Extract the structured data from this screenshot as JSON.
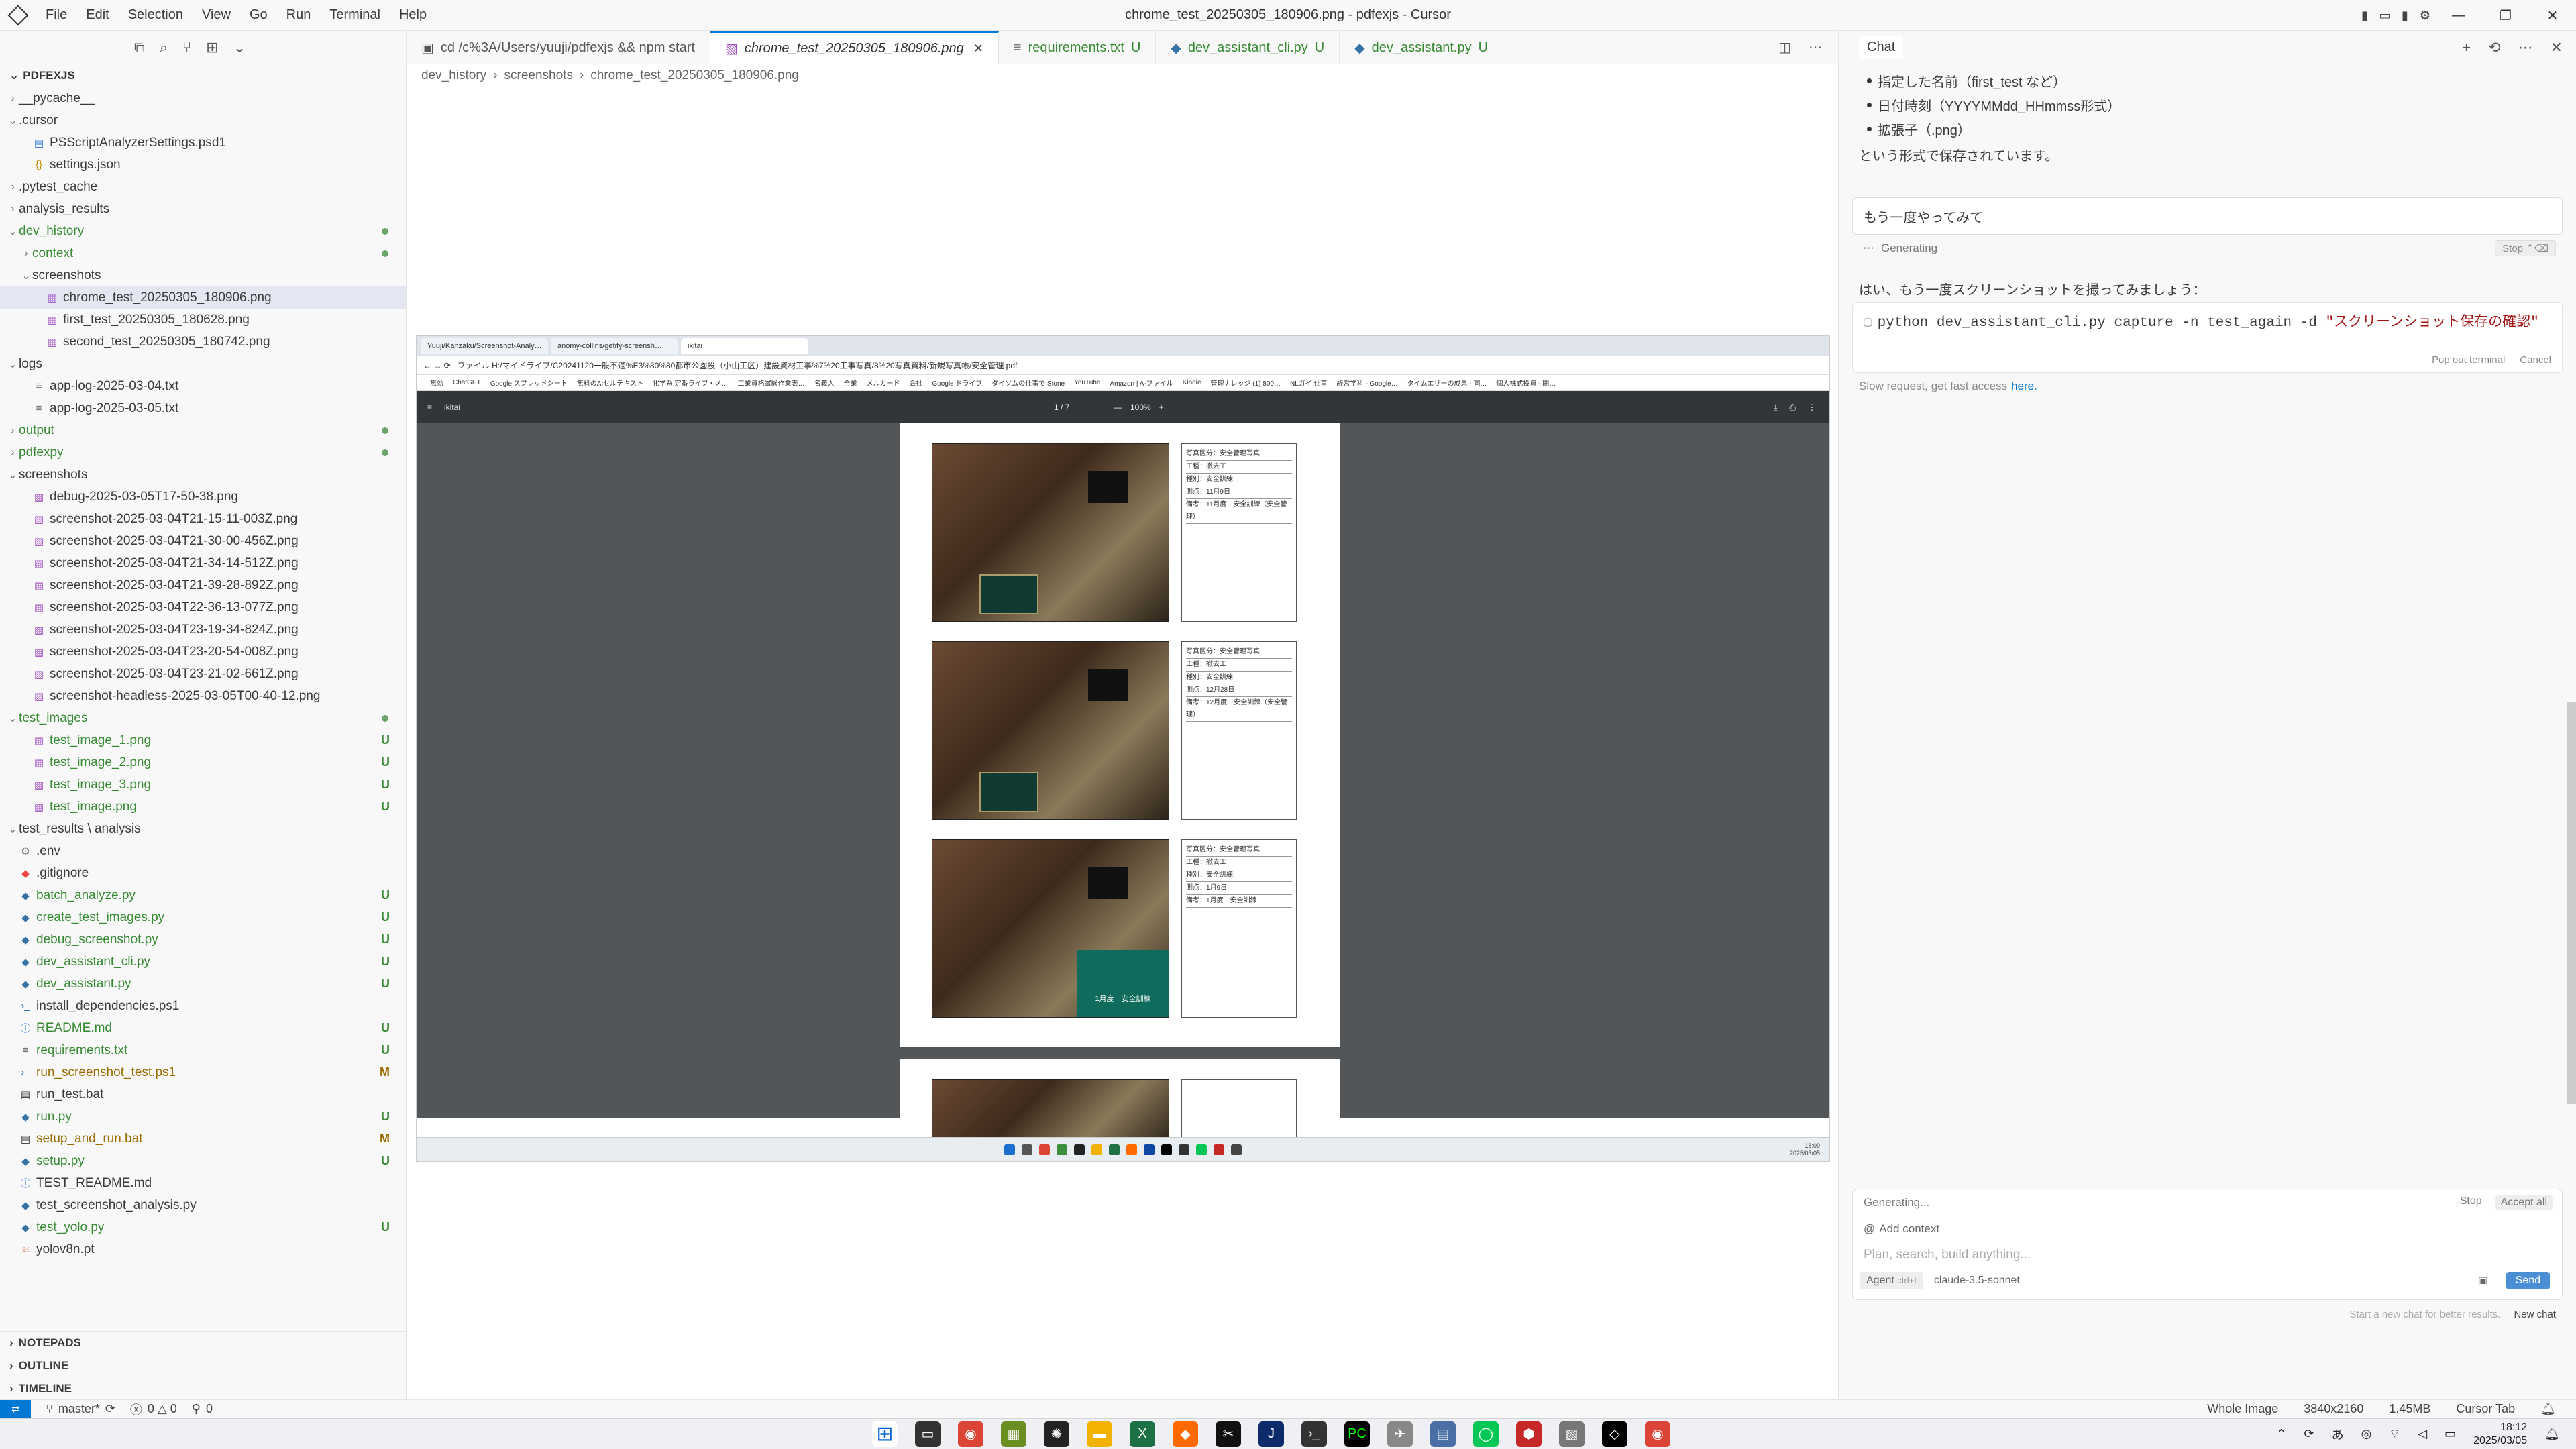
{
  "titlebar": {
    "menu": [
      "File",
      "Edit",
      "Selection",
      "View",
      "Go",
      "Run",
      "Terminal",
      "Help"
    ],
    "title": "chrome_test_20250305_180906.png - pdfexjs - Cursor"
  },
  "explorer": {
    "header": "PDFEXJS",
    "items": [
      {
        "label": "__pycache__",
        "kind": "folder",
        "open": false,
        "level": 1,
        "status": ""
      },
      {
        "label": ".cursor",
        "kind": "folder",
        "open": true,
        "level": 1,
        "status": ""
      },
      {
        "label": "PSScriptAnalyzerSettings.psd1",
        "kind": "file",
        "level": 2,
        "status": ""
      },
      {
        "label": "settings.json",
        "kind": "json",
        "level": 2,
        "status": ""
      },
      {
        "label": ".pytest_cache",
        "kind": "folder",
        "open": false,
        "level": 1,
        "status": ""
      },
      {
        "label": "analysis_results",
        "kind": "folder",
        "open": false,
        "level": 1,
        "status": ""
      },
      {
        "label": "dev_history",
        "kind": "folder",
        "open": true,
        "level": 1,
        "status": "dot"
      },
      {
        "label": "context",
        "kind": "folder",
        "open": false,
        "level": 2,
        "status": "dot"
      },
      {
        "label": "screenshots",
        "kind": "folder",
        "open": true,
        "level": 2,
        "status": ""
      },
      {
        "label": "chrome_test_20250305_180906.png",
        "kind": "img",
        "level": 3,
        "status": "",
        "selected": true
      },
      {
        "label": "first_test_20250305_180628.png",
        "kind": "img",
        "level": 3,
        "status": ""
      },
      {
        "label": "second_test_20250305_180742.png",
        "kind": "img",
        "level": 3,
        "status": ""
      },
      {
        "label": "logs",
        "kind": "folder",
        "open": true,
        "level": 1,
        "status": ""
      },
      {
        "label": "app-log-2025-03-04.txt",
        "kind": "txt",
        "level": 2,
        "status": ""
      },
      {
        "label": "app-log-2025-03-05.txt",
        "kind": "txt",
        "level": 2,
        "status": ""
      },
      {
        "label": "output",
        "kind": "folder",
        "open": false,
        "level": 1,
        "status": "dot"
      },
      {
        "label": "pdfexpy",
        "kind": "folder",
        "open": false,
        "level": 1,
        "status": "dot"
      },
      {
        "label": "screenshots",
        "kind": "folder",
        "open": true,
        "level": 1,
        "status": ""
      },
      {
        "label": "debug-2025-03-05T17-50-38.png",
        "kind": "img",
        "level": 2,
        "status": ""
      },
      {
        "label": "screenshot-2025-03-04T21-15-11-003Z.png",
        "kind": "img",
        "level": 2,
        "status": ""
      },
      {
        "label": "screenshot-2025-03-04T21-30-00-456Z.png",
        "kind": "img",
        "level": 2,
        "status": ""
      },
      {
        "label": "screenshot-2025-03-04T21-34-14-512Z.png",
        "kind": "img",
        "level": 2,
        "status": ""
      },
      {
        "label": "screenshot-2025-03-04T21-39-28-892Z.png",
        "kind": "img",
        "level": 2,
        "status": ""
      },
      {
        "label": "screenshot-2025-03-04T22-36-13-077Z.png",
        "kind": "img",
        "level": 2,
        "status": ""
      },
      {
        "label": "screenshot-2025-03-04T23-19-34-824Z.png",
        "kind": "img",
        "level": 2,
        "status": ""
      },
      {
        "label": "screenshot-2025-03-04T23-20-54-008Z.png",
        "kind": "img",
        "level": 2,
        "status": ""
      },
      {
        "label": "screenshot-2025-03-04T23-21-02-661Z.png",
        "kind": "img",
        "level": 2,
        "status": ""
      },
      {
        "label": "screenshot-headless-2025-03-05T00-40-12.png",
        "kind": "img",
        "level": 2,
        "status": ""
      },
      {
        "label": "test_images",
        "kind": "folder",
        "open": true,
        "level": 1,
        "status": "dot"
      },
      {
        "label": "test_image_1.png",
        "kind": "img",
        "level": 2,
        "status": "U"
      },
      {
        "label": "test_image_2.png",
        "kind": "img",
        "level": 2,
        "status": "U"
      },
      {
        "label": "test_image_3.png",
        "kind": "img",
        "level": 2,
        "status": "U"
      },
      {
        "label": "test_image.png",
        "kind": "img",
        "level": 2,
        "status": "U"
      },
      {
        "label": "test_results \\ analysis",
        "kind": "folder",
        "open": true,
        "level": 1,
        "status": ""
      },
      {
        "label": ".env",
        "kind": "gear",
        "level": 1,
        "status": ""
      },
      {
        "label": ".gitignore",
        "kind": "git",
        "level": 1,
        "status": ""
      },
      {
        "label": "batch_analyze.py",
        "kind": "py",
        "level": 1,
        "status": "U"
      },
      {
        "label": "create_test_images.py",
        "kind": "py",
        "level": 1,
        "status": "U"
      },
      {
        "label": "debug_screenshot.py",
        "kind": "py",
        "level": 1,
        "status": "U"
      },
      {
        "label": "dev_assistant_cli.py",
        "kind": "py",
        "level": 1,
        "status": "U"
      },
      {
        "label": "dev_assistant.py",
        "kind": "py",
        "level": 1,
        "status": "U"
      },
      {
        "label": "install_dependencies.ps1",
        "kind": "ps",
        "level": 1,
        "status": ""
      },
      {
        "label": "README.md",
        "kind": "md",
        "level": 1,
        "status": "U"
      },
      {
        "label": "requirements.txt",
        "kind": "txt",
        "level": 1,
        "status": "U"
      },
      {
        "label": "run_screenshot_test.ps1",
        "kind": "ps",
        "level": 1,
        "status": "M"
      },
      {
        "label": "run_test.bat",
        "kind": "bat",
        "level": 1,
        "status": ""
      },
      {
        "label": "run.py",
        "kind": "py",
        "level": 1,
        "status": "U"
      },
      {
        "label": "setup_and_run.bat",
        "kind": "bat",
        "level": 1,
        "status": "M"
      },
      {
        "label": "setup.py",
        "kind": "py",
        "level": 1,
        "status": "U"
      },
      {
        "label": "TEST_README.md",
        "kind": "md",
        "level": 1,
        "status": ""
      },
      {
        "label": "test_screenshot_analysis.py",
        "kind": "py",
        "level": 1,
        "status": ""
      },
      {
        "label": "test_yolo.py",
        "kind": "py",
        "level": 1,
        "status": "U"
      },
      {
        "label": "yolov8n.pt",
        "kind": "pt",
        "level": 1,
        "status": ""
      }
    ],
    "panels": [
      "NOTEPADS",
      "OUTLINE",
      "TIMELINE"
    ]
  },
  "editor": {
    "tabs": [
      {
        "label": "cd /c%3A/Users/yuuji/pdfexjs && npm start",
        "status": "",
        "active": false
      },
      {
        "label": "chrome_test_20250305_180906.png",
        "status": "",
        "active": true
      },
      {
        "label": "requirements.txt",
        "status": "U",
        "active": false
      },
      {
        "label": "dev_assistant_cli.py",
        "status": "U",
        "active": false
      },
      {
        "label": "dev_assistant.py",
        "status": "U",
        "active": false
      }
    ],
    "breadcrumb": [
      "dev_history",
      "screenshots",
      "chrome_test_20250305_180906.png"
    ]
  },
  "preview": {
    "chrome_tabs": [
      "Yuuji/Kanzaku/Screenshot-Analy…",
      "anomy-collins/getify-screensh…",
      "ikitai"
    ],
    "address": "ファイル  H:/マイドライブ/C20241120一般不適%E3%80%80都市公園設（小山工区）建設資材工事%7%20工事写真/8%20写真資料/新規写真帳/安全管理.pdf",
    "bookmarks": [
      "無効",
      "ChatGPT",
      "Google スプレッドシート",
      "無料のAIセルテキスト",
      "化学系 定番ライブ・メ…",
      "工業資格試験作業表…",
      "名義人",
      "全業",
      "メルカード",
      "会社",
      "Google ドライブ",
      "ダイソムの仕事で Stone",
      "YouTube",
      "Amazon | A-ファイル",
      "Kindle",
      "管理ナレッジ (1) 800…",
      "NLガイ 仕事",
      "経営学科 - Google…",
      "タイムエリーの成果 - 同…",
      "個人株式投資 - 関…"
    ],
    "pdf_filename": "ikitai",
    "page_indicator": "1 / 7",
    "zoom": "100%",
    "captions": [
      [
        "写真区分：安全管理写真",
        "工種：撤去工",
        "種別：安全訓練",
        "測点：11月9日",
        "備考：11月度　安全訓練（安全管理）"
      ],
      [
        "写真区分：安全管理写真",
        "工種：撤去工",
        "種別：安全訓練",
        "測点：12月28日",
        "備考：12月度　安全訓練（安全管理）"
      ],
      [
        "写真区分：安全管理写真",
        "工種：撤去工",
        "種別：安全訓練",
        "測点：1月9日",
        "備考：1月度　安全訓練"
      ]
    ],
    "photo3_board": "1月度　安全訓練",
    "clock_time": "18:09",
    "clock_date": "2025/03/05"
  },
  "chat": {
    "tab_label": "Chat",
    "bullets": [
      "指定した名前（first_test など）",
      "日付時刻（YYYYMMdd_HHmmss形式）",
      "拡張子（.png）"
    ],
    "saved_text": "という形式で保存されています。",
    "user_message": "もう一度やってみて",
    "generating": "Generating",
    "stop": "Stop",
    "stop_hint": "⌃⌫",
    "assistant_text": "はい、もう一度スクリーンショットを撮ってみましょう：",
    "command_plain": "python dev_assistant_cli.py capture -n test_again -d ",
    "command_string": "\"スクリーンショット保存の確認\"",
    "code_actions": [
      "Pop out terminal",
      "Cancel"
    ],
    "slow_text": "Slow request, get fast access",
    "slow_link": "here.",
    "input_generating": "Generating...",
    "input_stop": "Stop",
    "accept_all": "Accept all",
    "add_context": "Add context",
    "placeholder": "Plan, search, build anything...",
    "agent_label": "Agent",
    "agent_hint": "ctrl+I",
    "model": "claude-3.5-sonnet",
    "send": "Send",
    "new_chat_hint": "Start a new chat for better results.",
    "new_chat": "New chat"
  },
  "statusbar": {
    "branch": "master*",
    "problems": "0 △ 0",
    "ports": "0",
    "whole_image": "Whole Image",
    "dimensions": "3840x2160",
    "size": "1.45MB",
    "cursor_tab": "Cursor Tab"
  },
  "taskbar": {
    "time": "18:12",
    "date": "2025/03/05",
    "ime": "あ"
  }
}
